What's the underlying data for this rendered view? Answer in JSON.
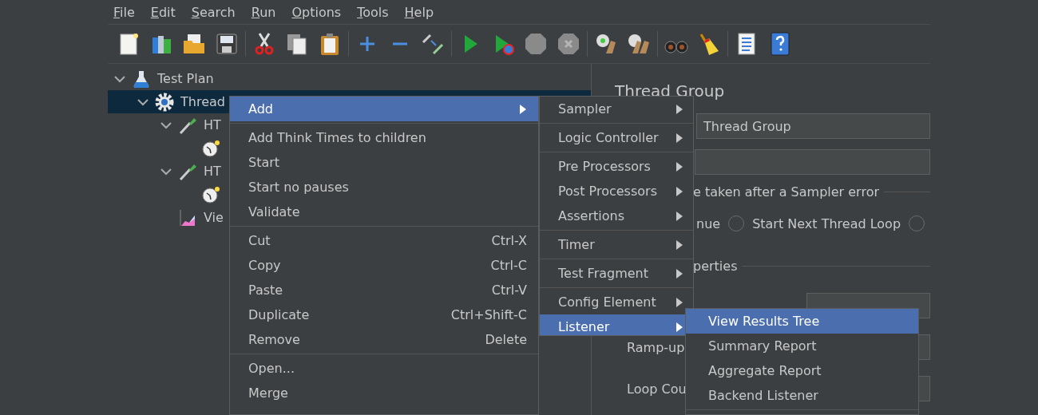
{
  "menubar": [
    {
      "label": "File"
    },
    {
      "label": "Edit"
    },
    {
      "label": "Search"
    },
    {
      "label": "Run"
    },
    {
      "label": "Options"
    },
    {
      "label": "Tools"
    },
    {
      "label": "Help"
    }
  ],
  "toolbar": [
    [
      {
        "kind": "new"
      },
      {
        "kind": "templates"
      },
      {
        "kind": "open"
      },
      {
        "kind": "save"
      }
    ],
    [
      {
        "kind": "cut"
      },
      {
        "kind": "copy"
      },
      {
        "kind": "paste"
      }
    ],
    [
      {
        "kind": "add"
      },
      {
        "kind": "remove"
      },
      {
        "kind": "toggle"
      }
    ],
    [
      {
        "kind": "start"
      },
      {
        "kind": "start_no_pauses"
      },
      {
        "kind": "stop"
      },
      {
        "kind": "shutdown"
      }
    ],
    [
      {
        "kind": "clear"
      },
      {
        "kind": "clear_all"
      }
    ],
    [
      {
        "kind": "search"
      },
      {
        "kind": "reset"
      }
    ],
    [
      {
        "kind": "function"
      },
      {
        "kind": "help"
      }
    ]
  ],
  "tree": [
    {
      "label": "Test Plan",
      "kind": "flask",
      "expanded": true,
      "selected": false,
      "children": [
        {
          "label": "Thread",
          "kind": "gear",
          "expanded": true,
          "selected": true,
          "children": [
            {
              "label": "HT",
              "kind": "pipette",
              "expanded": true,
              "selected": false,
              "children": [
                {
                  "kind": "timer",
                  "selected": false
                }
              ]
            },
            {
              "label": "HT",
              "kind": "pipette",
              "expanded": true,
              "selected": false,
              "children": [
                {
                  "kind": "timer",
                  "selected": false
                }
              ]
            },
            {
              "label": "Vie",
              "kind": "chart",
              "selected": false
            }
          ]
        }
      ]
    }
  ],
  "panel": {
    "title": "Thread Group",
    "name_value": "Thread Group",
    "error_group_label": "e taken after a Sampler error",
    "radios": [
      {
        "label": "nue"
      },
      {
        "label": "Start Next Thread Loop",
        "selected": false
      },
      {
        "selected": false
      }
    ],
    "properties_label": "perties",
    "properties": [
      {
        "label": "Ramp-up"
      },
      {
        "label": "Loop Cou"
      }
    ]
  },
  "context_menu": [
    {
      "kind": "item",
      "label": "Add",
      "selected": true,
      "submenu": true
    },
    {
      "kind": "separator"
    },
    {
      "kind": "item",
      "label": "Add Think Times to children",
      "selected": false,
      "submenu": false
    },
    {
      "kind": "item",
      "label": "Start",
      "selected": false,
      "submenu": false
    },
    {
      "kind": "item",
      "label": "Start no pauses",
      "selected": false,
      "submenu": false
    },
    {
      "kind": "item",
      "label": "Validate",
      "selected": false,
      "submenu": false
    },
    {
      "kind": "separator"
    },
    {
      "kind": "item",
      "label": "Cut",
      "shortcut": "Ctrl-X",
      "selected": false,
      "submenu": false
    },
    {
      "kind": "item",
      "label": "Copy",
      "shortcut": "Ctrl-C",
      "selected": false,
      "submenu": false
    },
    {
      "kind": "item",
      "label": "Paste",
      "shortcut": "Ctrl-V",
      "selected": false,
      "submenu": false
    },
    {
      "kind": "item",
      "label": "Duplicate",
      "shortcut": "Ctrl+Shift-C",
      "selected": false,
      "submenu": false
    },
    {
      "kind": "item",
      "label": "Remove",
      "shortcut": "Delete",
      "selected": false,
      "submenu": false
    },
    {
      "kind": "separator"
    },
    {
      "kind": "item",
      "label": "Open...",
      "selected": false,
      "submenu": false
    },
    {
      "kind": "item",
      "label": "Merge",
      "selected": false,
      "submenu": false
    }
  ],
  "add_submenu": [
    {
      "kind": "item",
      "label": "Sampler",
      "selected": false,
      "submenu": true
    },
    {
      "kind": "separator"
    },
    {
      "kind": "item",
      "label": "Logic Controller",
      "selected": false,
      "submenu": true
    },
    {
      "kind": "separator"
    },
    {
      "kind": "item",
      "label": "Pre Processors",
      "selected": false,
      "submenu": true
    },
    {
      "kind": "item",
      "label": "Post Processors",
      "selected": false,
      "submenu": true
    },
    {
      "kind": "item",
      "label": "Assertions",
      "selected": false,
      "submenu": true
    },
    {
      "kind": "separator"
    },
    {
      "kind": "item",
      "label": "Timer",
      "selected": false,
      "submenu": true
    },
    {
      "kind": "separator"
    },
    {
      "kind": "item",
      "label": "Test Fragment",
      "selected": false,
      "submenu": true
    },
    {
      "kind": "separator"
    },
    {
      "kind": "item",
      "label": "Config Element",
      "selected": false,
      "submenu": true
    },
    {
      "kind": "item",
      "label": "Listener",
      "selected": true,
      "submenu": true
    }
  ],
  "listener_submenu": [
    {
      "kind": "item",
      "label": "View Results Tree",
      "selected": true,
      "submenu": false
    },
    {
      "kind": "item",
      "label": "Summary Report",
      "selected": false,
      "submenu": false
    },
    {
      "kind": "item",
      "label": "Aggregate Report",
      "selected": false,
      "submenu": false
    },
    {
      "kind": "item",
      "label": "Backend Listener",
      "selected": false,
      "submenu": false
    },
    {
      "kind": "separator"
    }
  ]
}
